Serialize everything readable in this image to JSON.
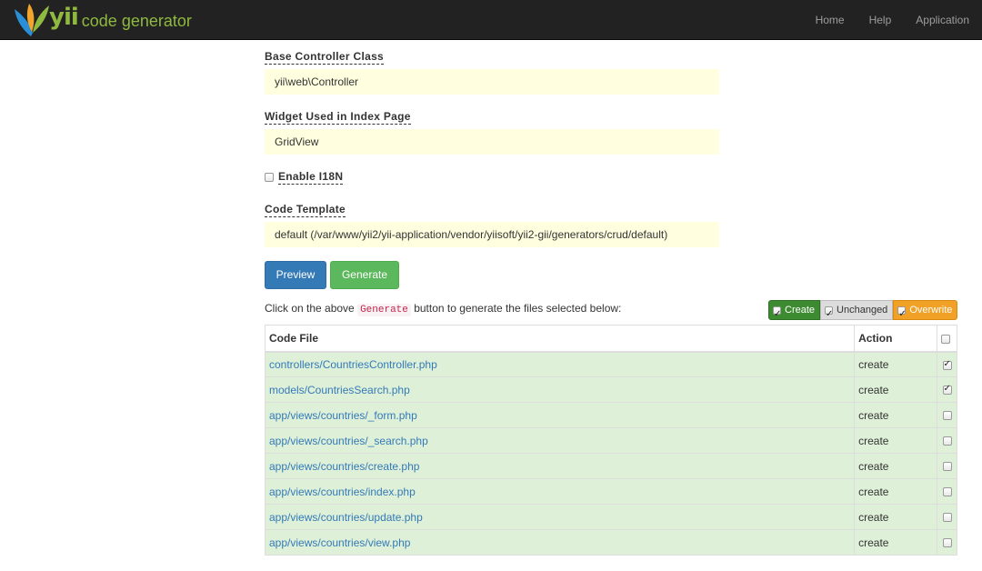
{
  "navbar": {
    "brand_yii": "yii",
    "brand_text": "code generator",
    "links": [
      "Home",
      "Help",
      "Application"
    ]
  },
  "form": {
    "base_controller": {
      "label": "Base Controller Class",
      "value": "yii\\web\\Controller"
    },
    "widget": {
      "label": "Widget Used in Index Page",
      "value": "GridView"
    },
    "i18n": {
      "label": "Enable I18N",
      "checked": false
    },
    "template": {
      "label": "Code Template",
      "value": "default (/var/www/yii2/yii-application/vendor/yiisoft/yii2-gii/generators/crud/default)"
    }
  },
  "buttons": {
    "preview": "Preview",
    "generate": "Generate"
  },
  "info": {
    "before": "Click on the above ",
    "code": "Generate",
    "after": " button to generate the files selected below:"
  },
  "legend": {
    "create": "Create",
    "unchanged": "Unchanged",
    "overwrite": "Overwrite"
  },
  "table": {
    "headers": {
      "file": "Code File",
      "action": "Action"
    },
    "rows": [
      {
        "file": "controllers/CountriesController.php",
        "action": "create",
        "checked": true
      },
      {
        "file": "models/CountriesSearch.php",
        "action": "create",
        "checked": true
      },
      {
        "file": "app/views/countries/_form.php",
        "action": "create",
        "checked": false
      },
      {
        "file": "app/views/countries/_search.php",
        "action": "create",
        "checked": false
      },
      {
        "file": "app/views/countries/create.php",
        "action": "create",
        "checked": false
      },
      {
        "file": "app/views/countries/index.php",
        "action": "create",
        "checked": false
      },
      {
        "file": "app/views/countries/update.php",
        "action": "create",
        "checked": false
      },
      {
        "file": "app/views/countries/view.php",
        "action": "create",
        "checked": false
      }
    ]
  },
  "colors": {
    "navbar": "#222222",
    "brand": "#8fb93f",
    "input_bg": "#ffffe0",
    "primary": "#337ab7",
    "success": "#5cb85c",
    "row_success": "#dff0d8",
    "create": "#3c8b30",
    "overwrite": "#f0a126"
  }
}
